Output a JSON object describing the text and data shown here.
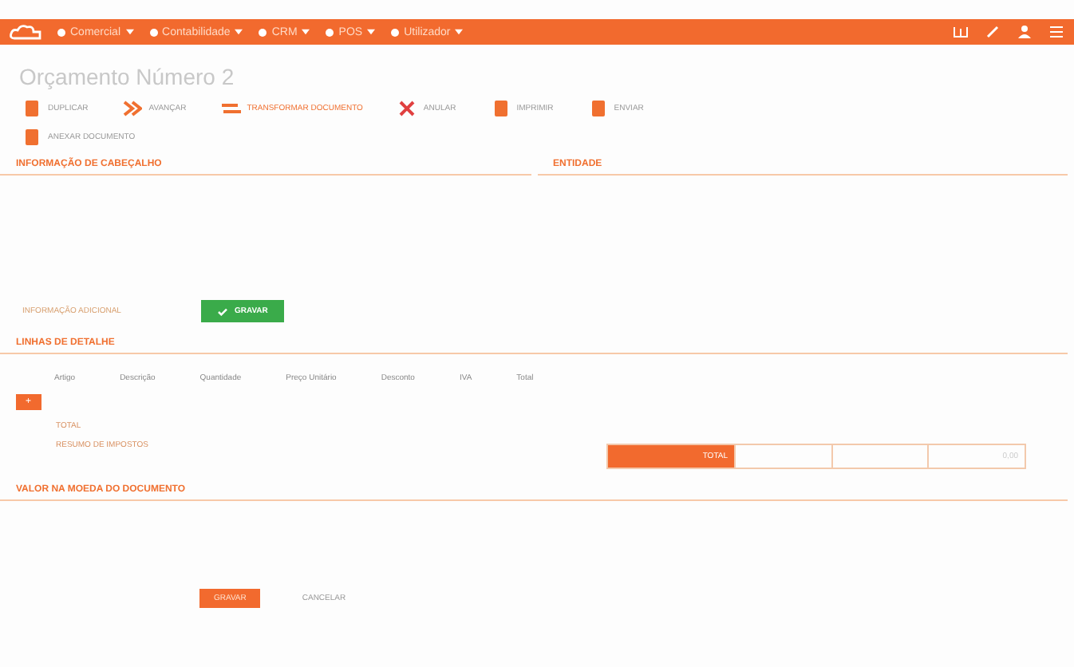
{
  "topbar": {
    "menus": [
      {
        "label": "Comercial"
      },
      {
        "label": "Contabilidade"
      },
      {
        "label": "CRM"
      },
      {
        "label": "POS"
      },
      {
        "label": "Utilizador"
      }
    ]
  },
  "title": "Orçamento Número 2",
  "toolbar": [
    {
      "label": "DUPLICAR",
      "kind": "copy"
    },
    {
      "label": "AVANÇAR",
      "kind": "forward"
    },
    {
      "label": "TRANSFORMAR DOCUMENTO",
      "kind": "transform"
    },
    {
      "label": "ANULAR",
      "kind": "cancel"
    },
    {
      "label": "IMPRIMIR",
      "kind": "print"
    },
    {
      "label": "ENVIAR",
      "kind": "send"
    },
    {
      "label": "ANEXAR DOCUMENTO",
      "kind": "attach"
    }
  ],
  "header_section": {
    "title": "INFORMAÇÃO DE CABEÇALHO",
    "save_button": "GRAVAR",
    "link": "INFORMAÇÃO ADICIONAL"
  },
  "entity_section": {
    "title": "ENTIDADE"
  },
  "lines_section": {
    "title": "LINHAS DE DETALHE",
    "columns": [
      "Artigo",
      "Descrição",
      "Quantidade",
      "Preço Unitário",
      "Desconto",
      "IVA",
      "Total"
    ],
    "add_button": "+",
    "rows": [
      {
        "label": "TOTAL"
      },
      {
        "label": "RESUMO DE IMPOSTOS"
      }
    ],
    "total_label": "TOTAL",
    "total_value": "0,00"
  },
  "value_section": {
    "title": "VALOR NA MOEDA DO DOCUMENTO"
  },
  "footer": {
    "primary": "GRAVAR",
    "secondary": "CANCELAR"
  }
}
